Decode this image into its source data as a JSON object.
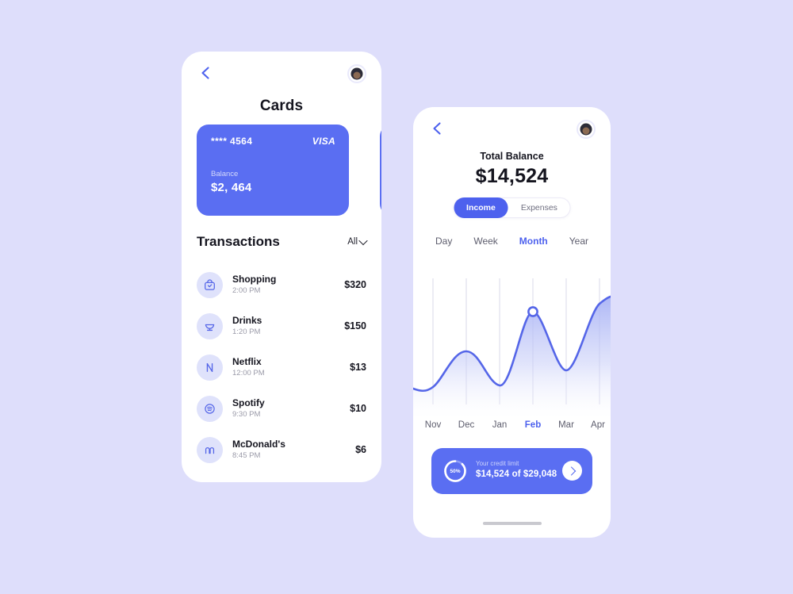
{
  "theme": {
    "background": "#dedefb",
    "accent": "#4d61ee",
    "card_blue": "#5a6ef2",
    "icon_bg": "#dfe2fb",
    "text_dark": "#15151f",
    "text_muted": "#9a9aa8"
  },
  "cards_screen": {
    "back_icon": "chevron-left-icon",
    "avatar_icon": "user-avatar",
    "title": "Cards",
    "cards": [
      {
        "number": "**** 4564",
        "brand": "VISA",
        "balance_label": "Balance",
        "balance_value": "$2, 464"
      },
      {
        "number": "",
        "brand": "",
        "balance_label": "",
        "balance_value": ""
      }
    ],
    "transactions_title": "Transactions",
    "filter_label": "All",
    "filter_icon": "chevron-down-icon",
    "transactions": [
      {
        "icon": "shopping-bag-icon",
        "name": "Shopping",
        "time": "2:00 PM",
        "amount": "$320"
      },
      {
        "icon": "drink-cup-icon",
        "name": "Drinks",
        "time": "1:20 PM",
        "amount": "$150"
      },
      {
        "icon": "netflix-icon",
        "name": "Netflix",
        "time": "12:00 PM",
        "amount": "$13"
      },
      {
        "icon": "spotify-icon",
        "name": "Spotify",
        "time": "9:30 PM",
        "amount": "$10"
      },
      {
        "icon": "mcdonalds-icon",
        "name": "McDonald's",
        "time": "8:45 PM",
        "amount": "$6"
      }
    ]
  },
  "stats_screen": {
    "back_icon": "chevron-left-icon",
    "avatar_icon": "user-avatar",
    "total_label": "Total Balance",
    "total_amount": "$14,524",
    "segments": [
      {
        "label": "Income",
        "active": true
      },
      {
        "label": "Expenses",
        "active": false
      }
    ],
    "periods": [
      {
        "label": "Day",
        "active": false
      },
      {
        "label": "Week",
        "active": false
      },
      {
        "label": "Month",
        "active": true
      },
      {
        "label": "Year",
        "active": false
      }
    ],
    "credit_limit": {
      "percent_label": "50%",
      "percent_value": 50,
      "label": "Your credit limit",
      "value": "$14,524 of $29,048",
      "arrow_icon": "chevron-right-icon"
    },
    "home_indicator": "home-indicator-bar"
  },
  "chart_data": {
    "type": "area",
    "title": "",
    "xlabel": "",
    "ylabel": "",
    "grid": true,
    "legend": null,
    "categories": [
      "Nov",
      "Dec",
      "Jan",
      "Feb",
      "Mar",
      "Apr"
    ],
    "series": [
      {
        "name": "Income",
        "values": [
          12,
          48,
          18,
          90,
          33,
          96
        ],
        "line_color": "#5566e8",
        "fill_from": "#b9c1f7",
        "fill_to": "#ffffff"
      }
    ],
    "ylim": [
      0,
      100
    ],
    "highlight": {
      "category": "Feb",
      "value": 90,
      "marker": "circle"
    }
  }
}
